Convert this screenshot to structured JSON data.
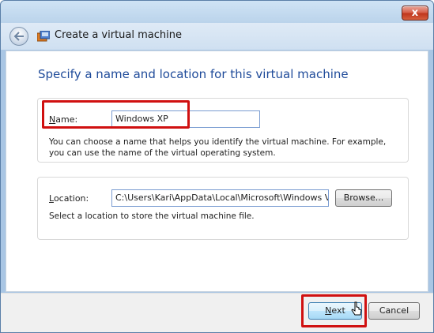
{
  "window": {
    "title": "Create a virtual machine",
    "close_glyph": "x"
  },
  "page": {
    "heading": "Specify a name and location for this virtual machine"
  },
  "name_section": {
    "label_accel": "N",
    "label_rest": "ame:",
    "value": "Windows XP",
    "hint_line1": "You can choose a name that helps you identify the virtual machine. For example,",
    "hint_line2": "you can use the name of the virtual operating system."
  },
  "location_section": {
    "label_accel": "L",
    "label_rest": "ocation:",
    "value": "C:\\Users\\Kari\\AppData\\Local\\Microsoft\\Windows Vir",
    "browse_label": "Browse...",
    "hint": "Select a location to store the virtual machine file."
  },
  "footer": {
    "next_accel": "N",
    "next_rest": "ext",
    "cancel_label": "Cancel"
  },
  "colors": {
    "heading": "#1f4b9a",
    "highlight": "#d01010",
    "close_button": "#c0361c"
  },
  "icons": [
    "back-arrow-icon",
    "virtual-machine-icon",
    "close-icon",
    "mouse-cursor-icon"
  ]
}
